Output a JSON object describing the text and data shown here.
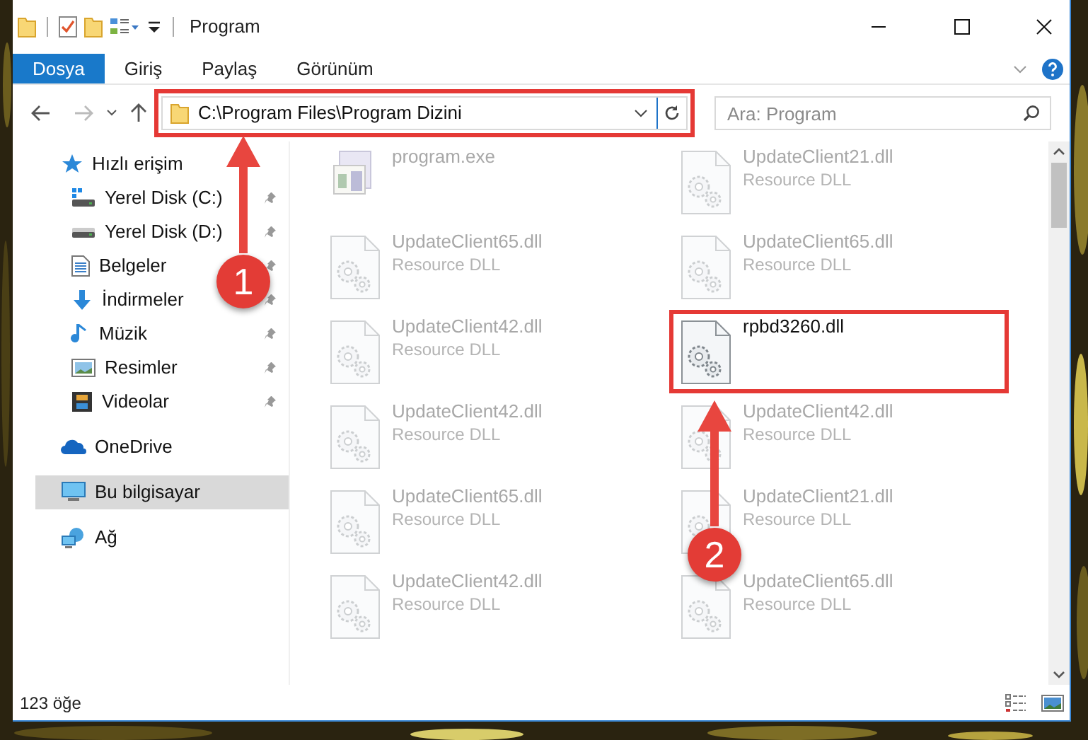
{
  "window": {
    "title": "Program"
  },
  "ribbon_tabs": [
    {
      "label": "Dosya",
      "selected": true
    },
    {
      "label": "Giriş",
      "selected": false
    },
    {
      "label": "Paylaş",
      "selected": false
    },
    {
      "label": "Görünüm",
      "selected": false
    }
  ],
  "address_bar": {
    "path": "C:\\Program Files\\Program Dizini",
    "highlighted": true
  },
  "search": {
    "placeholder": "Ara: Program"
  },
  "sidebar": {
    "items": [
      {
        "label": "Hızlı erişim",
        "kind": "star",
        "selected": false,
        "children": [
          {
            "label": "Yerel Disk (C:)",
            "kind": "drive-c",
            "pinned": true
          },
          {
            "label": "Yerel Disk (D:)",
            "kind": "drive",
            "pinned": true
          },
          {
            "label": "Belgeler",
            "kind": "document",
            "pinned": true
          },
          {
            "label": "İndirmeler",
            "kind": "download",
            "pinned": true
          },
          {
            "label": "Müzik",
            "kind": "music",
            "pinned": true
          },
          {
            "label": "Resimler",
            "pinned": true
          },
          {
            "label": "Videolar",
            "kind": "video",
            "pinned": true
          }
        ]
      },
      {
        "label": "OneDrive",
        "kind": "cloud",
        "selected": false
      },
      {
        "label": "Bu bilgisayar",
        "kind": "computer",
        "selected": true
      },
      {
        "label": "Ağ",
        "kind": "network",
        "selected": false
      }
    ]
  },
  "files": [
    {
      "name": "program.exe",
      "kind": "exe",
      "faded": true,
      "highlighted": false
    },
    {
      "name": "UpdateClient21.dll",
      "type": "Resource DLL",
      "kind": "dll",
      "faded": true,
      "highlighted": false
    },
    {
      "name": "UpdateClient65.dll",
      "type": "Resource DLL",
      "kind": "dll",
      "faded": true,
      "highlighted": false
    },
    {
      "name": "UpdateClient65.dll",
      "type": "Resource DLL",
      "kind": "dll",
      "faded": true,
      "highlighted": false
    },
    {
      "name": "UpdateClient42.dll",
      "type": "Resource DLL",
      "kind": "dll",
      "faded": true,
      "highlighted": false
    },
    {
      "name": "rpbd3260.dll",
      "kind": "dll",
      "faded": false,
      "highlighted": true
    },
    {
      "name": "UpdateClient42.dll",
      "type": "Resource DLL",
      "kind": "dll",
      "faded": true,
      "highlighted": false
    },
    {
      "name": "UpdateClient42.dll",
      "type": "Resource DLL",
      "kind": "dll",
      "faded": true,
      "highlighted": false
    },
    {
      "name": "UpdateClient65.dll",
      "type": "Resource DLL",
      "kind": "dll",
      "faded": true,
      "highlighted": false
    },
    {
      "name": "UpdateClient21.dll",
      "type": "Resource DLL",
      "kind": "dll",
      "faded": true,
      "highlighted": false
    },
    {
      "name": "UpdateClient42.dll",
      "type": "Resource DLL",
      "kind": "dll",
      "faded": true,
      "highlighted": false
    },
    {
      "name": "UpdateClient65.dll",
      "type": "Resource DLL",
      "kind": "dll",
      "faded": true,
      "highlighted": false
    }
  ],
  "status_bar": {
    "item_count": "123 öğe"
  },
  "annotations": [
    {
      "label": "1"
    },
    {
      "label": "2"
    }
  ]
}
